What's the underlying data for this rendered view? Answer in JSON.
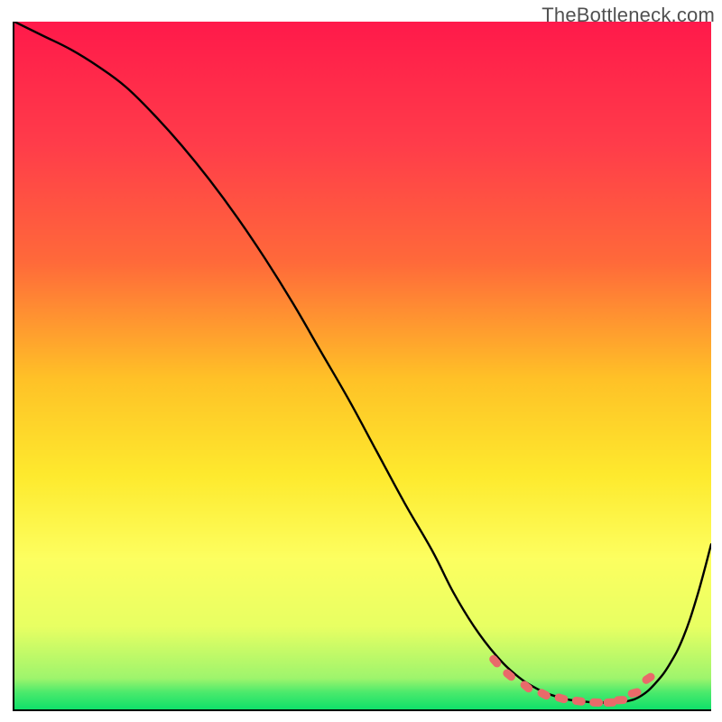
{
  "watermark": "TheBottleneck.com",
  "colors": {
    "top": "#ff1a4b",
    "mid1": "#ff6a3a",
    "mid2": "#ffc227",
    "mid3": "#feea2e",
    "mid4": "#fdff60",
    "mid5": "#e8ff63",
    "bottom": "#10e06a",
    "curve": "#000000",
    "marker": "#e96a6a",
    "markerStroke": "#e96a6a"
  },
  "chart_data": {
    "type": "line",
    "title": "",
    "xlabel": "",
    "ylabel": "",
    "xlim": [
      0,
      100
    ],
    "ylim": [
      0,
      100
    ],
    "series": [
      {
        "name": "bottleneck-curve",
        "x": [
          0,
          4,
          8,
          12,
          16,
          20,
          24,
          28,
          32,
          36,
          40,
          44,
          48,
          52,
          56,
          60,
          63,
          66,
          69,
          72,
          75,
          78,
          81,
          84,
          86,
          88,
          90,
          92,
          94,
          96,
          98,
          100
        ],
        "y": [
          100,
          98,
          96,
          93.5,
          90.5,
          86.5,
          82,
          77,
          71.5,
          65.5,
          59,
          52,
          45,
          37.5,
          30,
          23,
          17,
          12,
          8,
          5,
          3,
          1.8,
          1.2,
          1.0,
          1.0,
          1.2,
          2.0,
          3.8,
          6.5,
          10.5,
          16.5,
          24
        ]
      }
    ],
    "markers": {
      "name": "optimal-range",
      "x": [
        69,
        71,
        73.5,
        76,
        78.5,
        81,
        83.5,
        85.5,
        87,
        89,
        91
      ],
      "y": [
        7.0,
        5.0,
        3.3,
        2.2,
        1.6,
        1.2,
        1.0,
        1.0,
        1.35,
        2.4,
        4.5
      ]
    }
  }
}
